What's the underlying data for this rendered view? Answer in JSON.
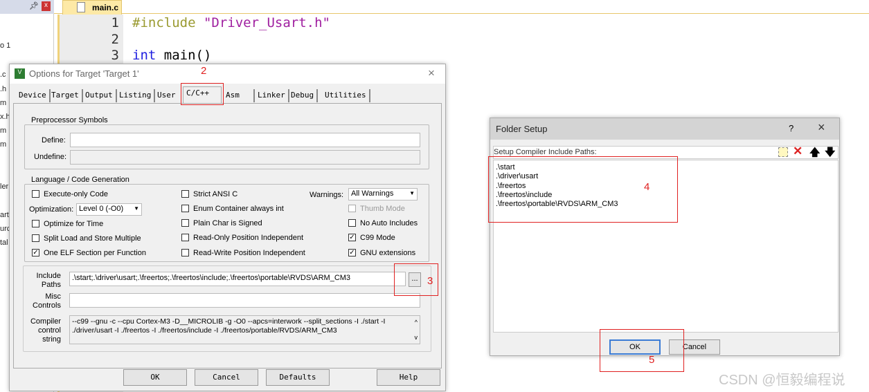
{
  "left_panel": {
    "items": [
      "o 1",
      ".c",
      ".h",
      "m",
      "x.h",
      "m",
      "m",
      "ler",
      "art",
      "urc",
      "tal"
    ]
  },
  "editor": {
    "tab": "main.c",
    "line_numbers": [
      "1",
      "2",
      "3"
    ],
    "lines": [
      {
        "kw": "#include",
        "str": "\"Driver_Usart.h\""
      },
      {
        "kw": "",
        "str": ""
      },
      {
        "kw": "int",
        "rest": " main()"
      }
    ]
  },
  "options": {
    "title": "Options for Target 'Target 1'",
    "tabs": [
      "Device",
      "Target",
      "Output",
      "Listing",
      "User",
      "C/C++",
      "Asm",
      "Linker",
      "Debug",
      "Utilities"
    ],
    "active_tab": "C/C++",
    "preproc": {
      "group": "Preprocessor Symbols",
      "define_label": "Define:",
      "define_value": "",
      "undefine_label": "Undefine:",
      "undefine_value": ""
    },
    "lang": {
      "group": "Language / Code Generation",
      "execute_only": {
        "label": "Execute-only Code",
        "checked": false
      },
      "optimization_label": "Optimization:",
      "optimization_value": "Level 0 (-O0)",
      "opt_time": {
        "label": "Optimize for Time",
        "checked": false
      },
      "split_load": {
        "label": "Split Load and Store Multiple",
        "checked": false
      },
      "one_elf": {
        "label": "One ELF Section per Function",
        "checked": true
      },
      "strict_ansi": {
        "label": "Strict ANSI C",
        "checked": false
      },
      "enum_container": {
        "label": "Enum Container always int",
        "checked": false
      },
      "plain_char": {
        "label": "Plain Char is Signed",
        "checked": false
      },
      "ro_pi": {
        "label": "Read-Only Position Independent",
        "checked": false
      },
      "rw_pi": {
        "label": "Read-Write Position Independent",
        "checked": false
      },
      "warnings_label": "Warnings:",
      "warnings_value": "All Warnings",
      "thumb": {
        "label": "Thumb Mode",
        "checked": false
      },
      "no_auto": {
        "label": "No Auto Includes",
        "checked": false
      },
      "c99": {
        "label": "C99 Mode",
        "checked": true
      },
      "gnu": {
        "label": "GNU extensions",
        "checked": true
      }
    },
    "include_label1": "Include",
    "include_label2": "Paths",
    "include_value": ".\\start;.\\driver\\usart;.\\freertos;.\\freertos\\include;.\\freertos\\portable\\RVDS\\ARM_CM3",
    "browse": "...",
    "misc_label1": "Misc",
    "misc_label2": "Controls",
    "misc_value": "",
    "ccs_label1": "Compiler",
    "ccs_label2": "control",
    "ccs_label3": "string",
    "ccs_line1": "--c99 --gnu -c --cpu Cortex-M3 -D__MICROLIB -g -O0 --apcs=interwork --split_sections -I ./start -I",
    "ccs_line2": "./driver/usart -I ./freertos -I ./freertos/include -I ./freertos/portable/RVDS/ARM_CM3",
    "buttons": {
      "ok": "OK",
      "cancel": "Cancel",
      "defaults": "Defaults",
      "help": "Help"
    }
  },
  "folder": {
    "title": "Folder Setup",
    "help": "?",
    "label": "Setup Compiler Include Paths:",
    "paths": [
      ".\\start",
      ".\\driver\\usart",
      ".\\freertos",
      ".\\freertos\\include",
      ".\\freertos\\portable\\RVDS\\ARM_CM3"
    ],
    "ok": "OK",
    "cancel": "Cancel"
  },
  "annotations": [
    "2",
    "3",
    "4",
    "5"
  ],
  "annotation_color": "#e02020",
  "watermark": "CSDN @恒毅编程说"
}
